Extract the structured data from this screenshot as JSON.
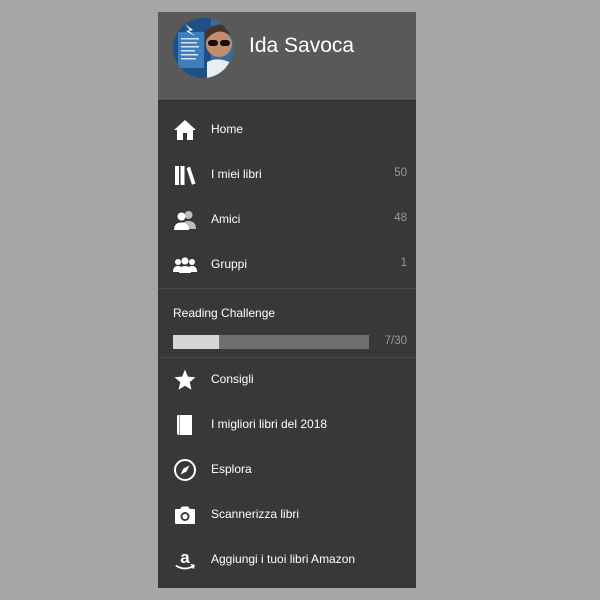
{
  "profile": {
    "name": "Ida Savoca"
  },
  "menu": {
    "primary": [
      {
        "label": "Home",
        "icon": "home-icon",
        "count": ""
      },
      {
        "label": "I miei libri",
        "icon": "books-icon",
        "count": "50"
      },
      {
        "label": "Amici",
        "icon": "friends-icon",
        "count": "48"
      },
      {
        "label": "Gruppi",
        "icon": "groups-icon",
        "count": "1"
      }
    ],
    "secondary": [
      {
        "label": "Consigli",
        "icon": "star-icon"
      },
      {
        "label": "I migliori libri del 2018",
        "icon": "book-icon"
      },
      {
        "label": "Esplora",
        "icon": "compass-icon"
      },
      {
        "label": "Scannerizza libri",
        "icon": "camera-icon"
      },
      {
        "label": "Aggiungi i tuoi libri Amazon",
        "icon": "amazon-icon"
      }
    ]
  },
  "challenge": {
    "title": "Reading Challenge",
    "progress_text": "7/30",
    "completed": 7,
    "goal": 30
  },
  "colors": {
    "background": "#a6a6a6",
    "drawer": "#383838",
    "header": "#595959",
    "progress_fill": "#d6d6d6",
    "progress_track": "#6f6f6f"
  }
}
